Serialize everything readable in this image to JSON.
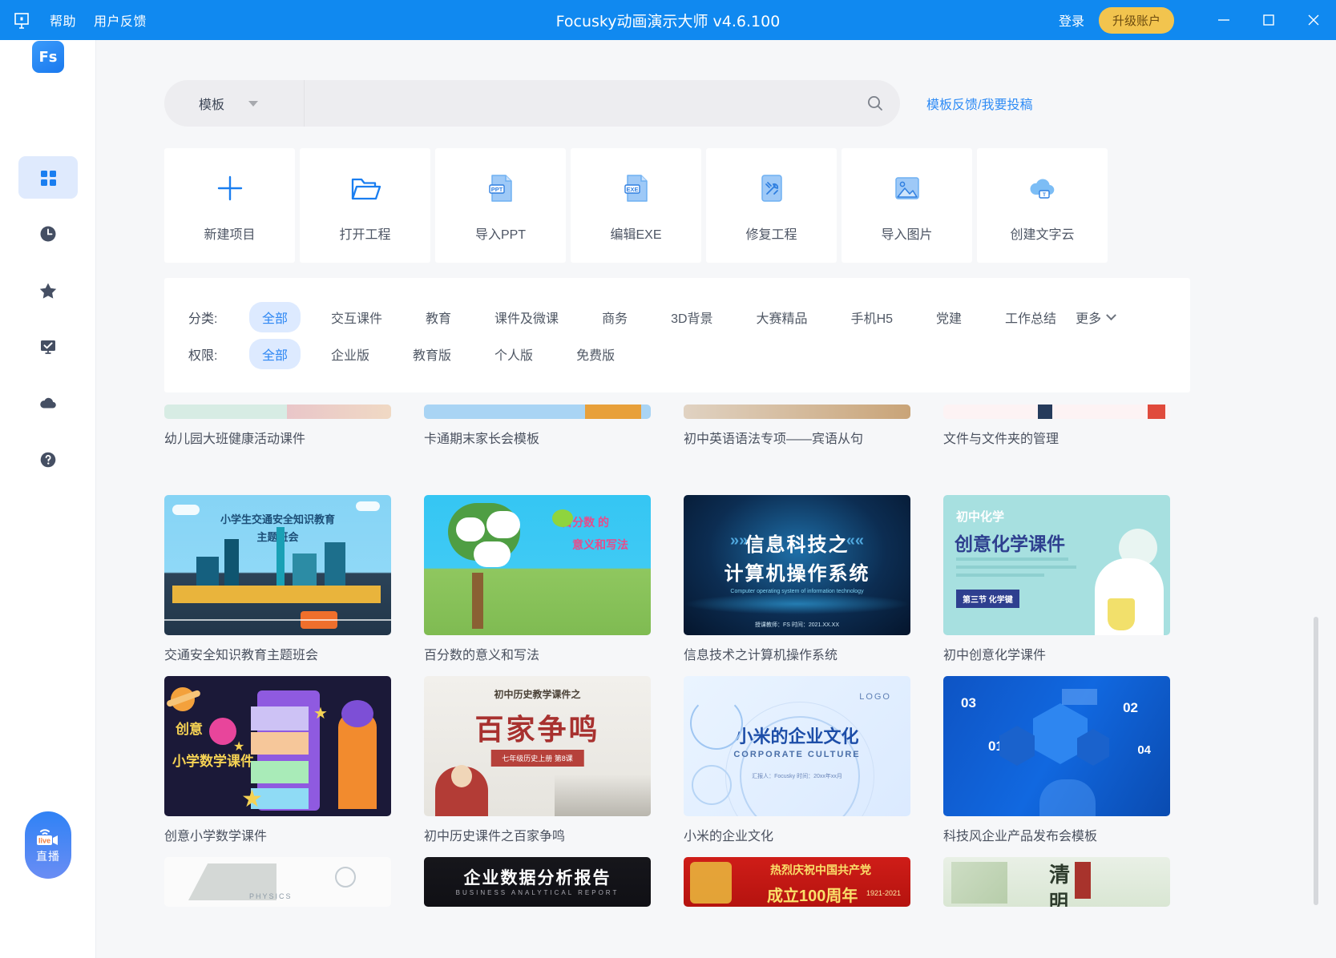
{
  "titlebar": {
    "logo_icon": "focusky-pin-icon",
    "menus": [
      "帮助",
      "用户反馈"
    ],
    "title": "Focusky动画演示大师 v4.6.100",
    "login": "登录",
    "upgrade": "升级账户",
    "minimize": "minimize-icon",
    "maximize": "maximize-icon",
    "close": "close-icon",
    "bg_color": "#1089f0",
    "upgrade_color": "#f2c44e"
  },
  "sidebar": {
    "logo": "Fs",
    "items": [
      {
        "name": "templates",
        "icon": "grid-icon",
        "active": true
      },
      {
        "name": "recent",
        "icon": "clock-icon",
        "active": false
      },
      {
        "name": "favorites",
        "icon": "star-icon",
        "active": false
      },
      {
        "name": "projects",
        "icon": "monitor-check-icon",
        "active": false
      },
      {
        "name": "cloud",
        "icon": "cloud-icon",
        "active": false
      },
      {
        "name": "help",
        "icon": "question-circle-icon",
        "active": false
      }
    ],
    "live": {
      "label": "直播",
      "badge": "live"
    }
  },
  "search": {
    "category": "模板",
    "dropdown_icon": "caret-down-icon",
    "value": "",
    "placeholder": "",
    "search_icon": "search-icon",
    "feedback_link": "模板反馈/我要投稿"
  },
  "actions": [
    {
      "label": "新建项目",
      "icon": "plus-icon"
    },
    {
      "label": "打开工程",
      "icon": "folder-open-icon"
    },
    {
      "label": "导入PPT",
      "icon": "ppt-file-icon"
    },
    {
      "label": "编辑EXE",
      "icon": "exe-file-icon"
    },
    {
      "label": "修复工程",
      "icon": "repair-tools-icon"
    },
    {
      "label": "导入图片",
      "icon": "image-icon"
    },
    {
      "label": "创建文字云",
      "icon": "text-cloud-icon"
    }
  ],
  "filters": {
    "category": {
      "label": "分类:",
      "options": [
        "全部",
        "交互课件",
        "教育",
        "课件及微课",
        "商务",
        "3D背景",
        "大赛精品",
        "手机H5",
        "党建",
        "工作总结"
      ],
      "selected": "全部",
      "more": "更多"
    },
    "permission": {
      "label": "权限:",
      "options": [
        "全部",
        "企业版",
        "教育版",
        "个人版",
        "免费版"
      ],
      "selected": "全部"
    }
  },
  "templates": [
    {
      "caption": "幼儿园大班健康活动课件",
      "thumb_kind": "partial-kindergarten"
    },
    {
      "caption": "卡通期末家长会模板",
      "thumb_kind": "partial-cartoon"
    },
    {
      "caption": "初中英语语法专项——宾语从句",
      "thumb_kind": "partial-english"
    },
    {
      "caption": "文件与文件夹的管理",
      "thumb_kind": "partial-files"
    },
    {
      "caption": "交通安全知识教育主题班会",
      "thumb_kind": "traffic",
      "thumb_title": "小学生交通安全知识教育",
      "thumb_sub": "主题班会"
    },
    {
      "caption": "百分数的意义和写法",
      "thumb_kind": "percent",
      "thumb_title": "百分数 的",
      "thumb_sub": "意义和写法"
    },
    {
      "caption": "信息技术之计算机操作系统",
      "thumb_kind": "infotech",
      "thumb_title": "信息科技之",
      "thumb_sub": "计算机操作系统",
      "thumb_note": "Computer operating system of information technology",
      "thumb_foot": "授课教师：FS    时间：2021.XX.XX"
    },
    {
      "caption": "初中创意化学课件",
      "thumb_kind": "chemistry",
      "thumb_title": "初中化学",
      "thumb_sub": "创意化学课件",
      "thumb_tag": "第三节 化学键"
    },
    {
      "caption": "创意小学数学课件",
      "thumb_kind": "math",
      "thumb_title": "创意",
      "thumb_sub": "小学数学课件"
    },
    {
      "caption": "初中历史课件之百家争鸣",
      "thumb_kind": "history",
      "thumb_title": "初中历史教学课件之",
      "thumb_sub": "百家争鸣",
      "thumb_tag": "七年级历史上册  第8课"
    },
    {
      "caption": "小米的企业文化",
      "thumb_kind": "xiaomi",
      "thumb_title": "小米的企业文化",
      "thumb_sub": "CORPORATE CULTURE",
      "thumb_tag": "LOGO",
      "thumb_foot": "汇报人：Focusky          时间：20xx年xx月"
    },
    {
      "caption": "科技风企业产品发布会模板",
      "thumb_kind": "tech",
      "thumb_nums": [
        "03",
        "01",
        "02",
        "04"
      ]
    },
    {
      "caption": "",
      "thumb_kind": "physics",
      "thumb_title": "PHYSICS"
    },
    {
      "caption": "",
      "thumb_kind": "bizdata",
      "thumb_title": "企业数据分析报告",
      "thumb_sub": "BUSINESS ANALYTICAL REPORT"
    },
    {
      "caption": "",
      "thumb_kind": "party",
      "thumb_title": "热烈庆祝中国共产党",
      "thumb_sub": "成立100周年",
      "thumb_tag": "1921-2021"
    },
    {
      "caption": "",
      "thumb_kind": "qingming",
      "thumb_title": "清",
      "thumb_sub": "明"
    }
  ]
}
